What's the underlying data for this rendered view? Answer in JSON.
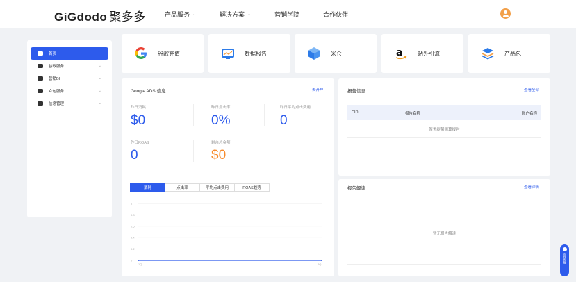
{
  "header": {
    "logo_latin": "GiGdodo",
    "logo_cn": "聚多多",
    "nav": [
      {
        "label": "产品服务",
        "has_dropdown": true
      },
      {
        "label": "解决方案",
        "has_dropdown": true
      },
      {
        "label": "营销学院",
        "has_dropdown": false
      },
      {
        "label": "合作伙伴",
        "has_dropdown": false
      }
    ]
  },
  "sidebar": {
    "items": [
      {
        "label": "首页",
        "icon": "home-icon",
        "active": true
      },
      {
        "label": "谷歌服务",
        "icon": "google-icon",
        "active": false
      },
      {
        "label": "营销BI",
        "icon": "bi-icon",
        "active": false
      },
      {
        "label": "众包服务",
        "icon": "users-icon",
        "active": false
      },
      {
        "label": "信息管理",
        "icon": "gear-icon",
        "active": false
      }
    ]
  },
  "services": [
    {
      "label": "谷歌充值",
      "icon": "google-icon"
    },
    {
      "label": "数据报告",
      "icon": "report-icon"
    },
    {
      "label": "米仓",
      "icon": "cube-icon"
    },
    {
      "label": "站外引流",
      "icon": "amazon-icon"
    },
    {
      "label": "产品包",
      "icon": "layers-icon"
    }
  ],
  "ads": {
    "title": "Google ADS 信息",
    "link": "去开户",
    "metrics": [
      {
        "label": "昨日消耗",
        "value": "$0"
      },
      {
        "label": "昨日点击率",
        "value": "0%"
      },
      {
        "label": "昨日平均点击费用",
        "value": "0"
      },
      {
        "label": "昨日ROAS",
        "value": "0"
      },
      {
        "label": "剩余总金额",
        "value": "$0"
      }
    ],
    "tabs": [
      "消耗",
      "点击率",
      "平均点击费用",
      "ROAS趋势"
    ],
    "active_tab": 0
  },
  "chart_data": {
    "type": "line",
    "x": [
      "1Q",
      "2Q"
    ],
    "y_ticks": [
      "0",
      "0.2",
      "0.4",
      "0.6",
      "0.8",
      "1"
    ],
    "ylim": [
      0,
      1
    ],
    "series": [
      {
        "values": [
          0,
          0
        ]
      }
    ]
  },
  "report_info": {
    "title": "报告信息",
    "link": "查看全部",
    "columns": [
      "CID",
      "报告名称",
      "账户名称"
    ],
    "empty_text": "暂无提醒测算报告"
  },
  "report_interp": {
    "title": "报告解读",
    "link": "查看详情",
    "empty_text": "暂无报告解读"
  },
  "float_button": {
    "label": "在线客服"
  },
  "colors": {
    "accent": "#2d5bec",
    "orange": "#f78b2c",
    "bg": "#f0f2f5"
  }
}
